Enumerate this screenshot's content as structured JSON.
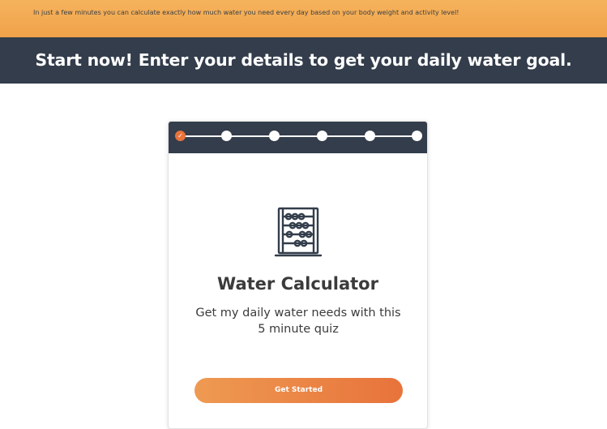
{
  "banner": {
    "text": "In just a few minutes you can calculate exactly how much water you need every day based on your body weight and activity level!"
  },
  "headline": {
    "text": "Start now! Enter your details to get your daily water goal."
  },
  "progress": {
    "current_step": 1,
    "total_steps": 6,
    "check_glyph": "✓"
  },
  "card": {
    "icon": "abacus-icon",
    "title": "Water Calculator",
    "subtitle": "Get my daily water needs with this 5 minute quiz",
    "button_label": "Get Started"
  },
  "colors": {
    "banner": "#f0a24a",
    "dark": "#333d4b",
    "accent": "#e8733b"
  }
}
